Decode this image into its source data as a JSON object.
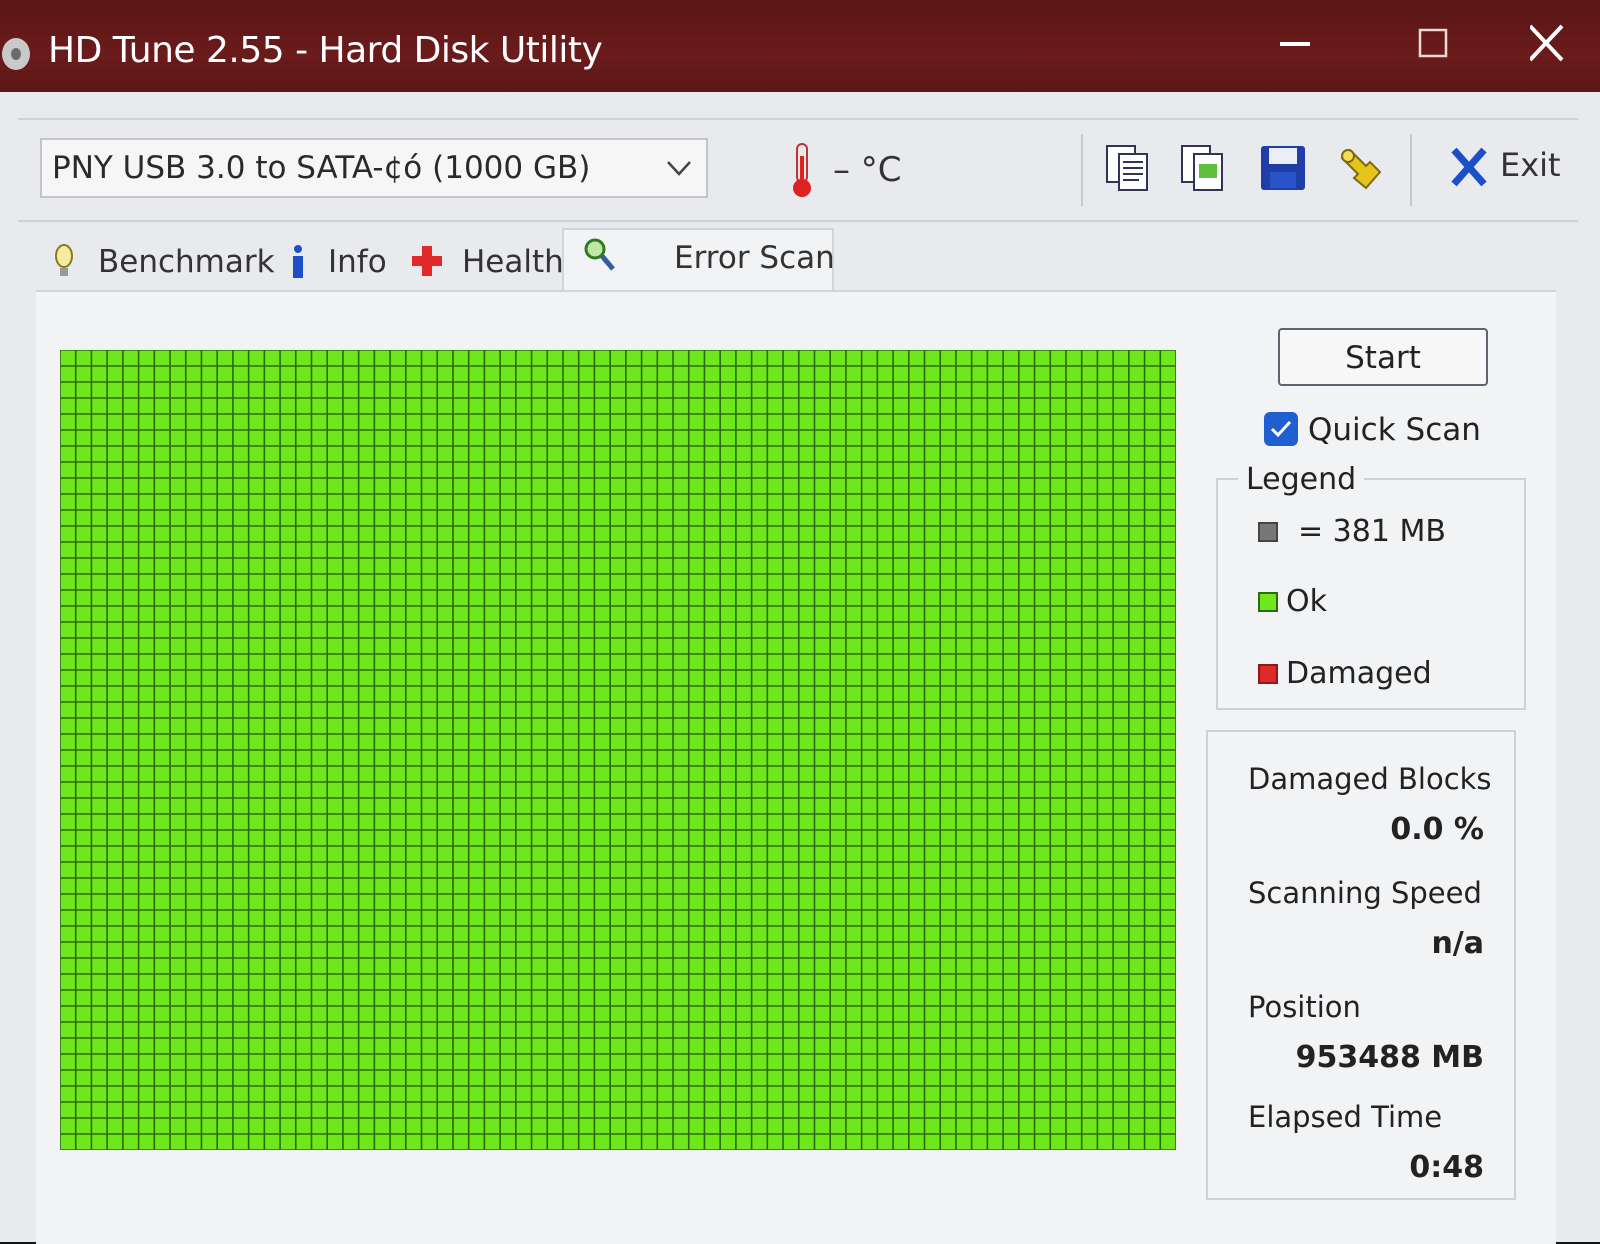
{
  "window": {
    "title": "HD Tune 2.55 - Hard Disk Utility"
  },
  "toolbar": {
    "drive": "PNY USB 3.0 to SATA-¢ó (1000 GB)",
    "temperature": "– °C",
    "exit_label": "Exit",
    "icons": [
      "copy-text-icon",
      "copy-screenshot-icon",
      "save-icon",
      "options-icon",
      "exit-icon"
    ]
  },
  "tabs": [
    {
      "label": "Benchmark",
      "icon": "lightbulb-icon"
    },
    {
      "label": "Info",
      "icon": "info-icon"
    },
    {
      "label": "Health",
      "icon": "health-cross-icon"
    },
    {
      "label": "Error Scan",
      "icon": "magnifier-icon",
      "active": true
    }
  ],
  "error_scan": {
    "start_label": "Start",
    "quick_scan_label": "Quick Scan",
    "quick_scan_checked": true,
    "legend": {
      "title": "Legend",
      "block_size": "= 381 MB",
      "ok_label": "Ok",
      "damaged_label": "Damaged"
    },
    "stats": {
      "damaged_blocks_label": "Damaged Blocks",
      "damaged_blocks_value": "0.0 %",
      "scanning_speed_label": "Scanning Speed",
      "scanning_speed_value": "n/a",
      "position_label": "Position",
      "position_value": "953488 MB",
      "elapsed_label": "Elapsed Time",
      "elapsed_value": "0:48"
    },
    "block_map": {
      "columns": 71,
      "rows": 50,
      "status": "ok"
    }
  },
  "colors": {
    "titlebar": "#6b1b1b",
    "ok_block": "#6ee81c",
    "grid_line": "#2d6a12",
    "damaged": "#e02a2a",
    "block_gray": "#777777",
    "checkbox": "#1f5fd0"
  }
}
